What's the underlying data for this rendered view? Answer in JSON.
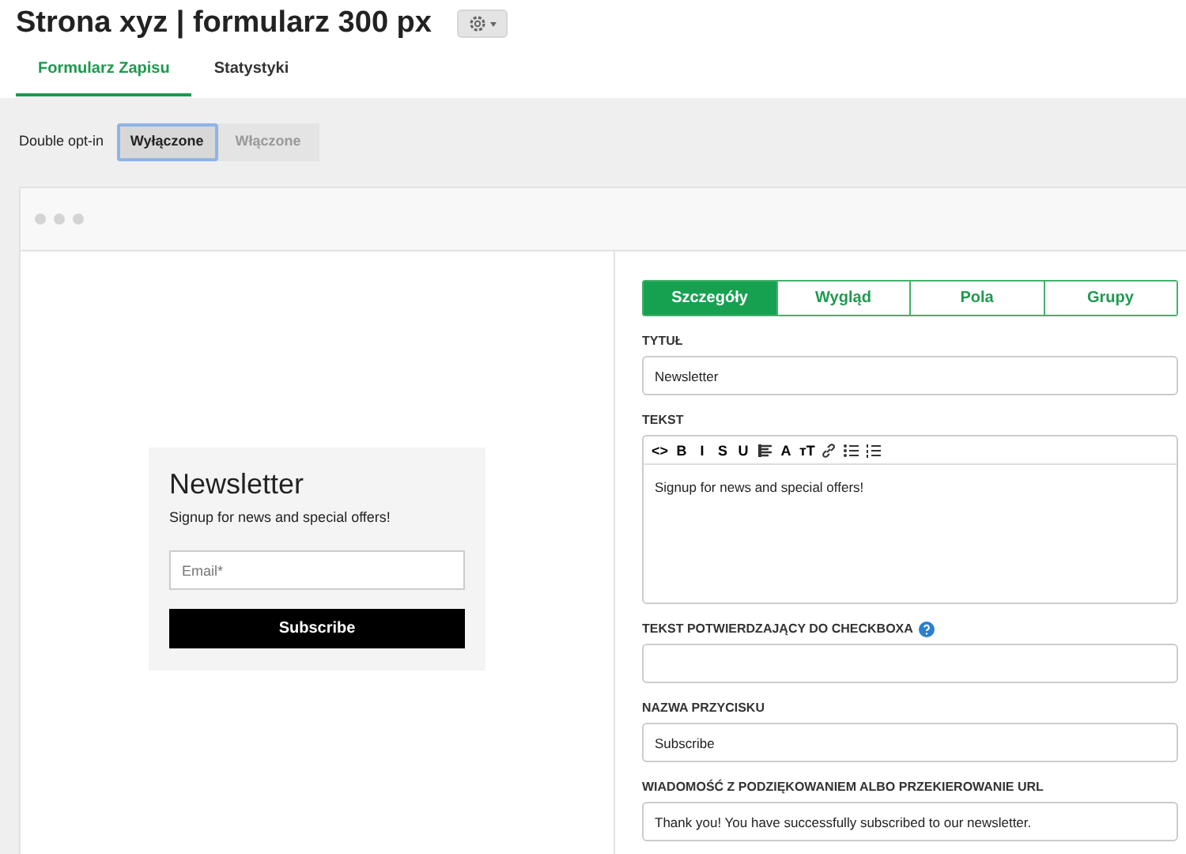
{
  "page_title": "Strona xyz | formularz 300 px",
  "tabs": [
    {
      "label": "Formularz Zapisu",
      "selected": true
    },
    {
      "label": "Statystyki",
      "selected": false
    }
  ],
  "double_opt_in": {
    "label": "Double opt-in",
    "options": [
      {
        "label": "Wyłączone",
        "selected": true
      },
      {
        "label": "Włączone",
        "selected": false
      }
    ]
  },
  "preview": {
    "title": "Newsletter",
    "text": "Signup for news and special offers!",
    "email_placeholder": "Email*",
    "button": "Subscribe"
  },
  "editor_tabs": [
    {
      "label": "Szczegóły",
      "selected": true
    },
    {
      "label": "Wygląd",
      "selected": false
    },
    {
      "label": "Pola",
      "selected": false
    },
    {
      "label": "Grupy",
      "selected": false
    }
  ],
  "fields": [
    {
      "kind": "input",
      "label": "TYTUŁ",
      "value": "Newsletter"
    },
    {
      "kind": "editor",
      "label": "TEKST",
      "value": "Signup for news and special offers!",
      "toolbar": [
        {
          "kind": "text",
          "label": "<>"
        },
        {
          "kind": "text",
          "label": "B"
        },
        {
          "kind": "text",
          "label": "I"
        },
        {
          "kind": "text",
          "label": "S"
        },
        {
          "kind": "text",
          "label": "U"
        },
        {
          "kind": "align"
        },
        {
          "kind": "text",
          "label": "A"
        },
        {
          "kind": "text",
          "label": "тT"
        },
        {
          "kind": "link"
        },
        {
          "kind": "bullets"
        },
        {
          "kind": "numbers"
        }
      ]
    },
    {
      "kind": "input",
      "label": "TEKST POTWIERDZAJĄCY DO CHECKBOXA",
      "help": true
    },
    {
      "kind": "input",
      "label": "NAZWA PRZYCISKU",
      "value": "Subscribe"
    },
    {
      "kind": "input",
      "label": "WIADOMOŚĆ Z PODZIĘKOWANIEM ALBO PRZEKIEROWANIE URL",
      "value": "Thank you! You have successfully subscribed to our newsletter."
    }
  ]
}
